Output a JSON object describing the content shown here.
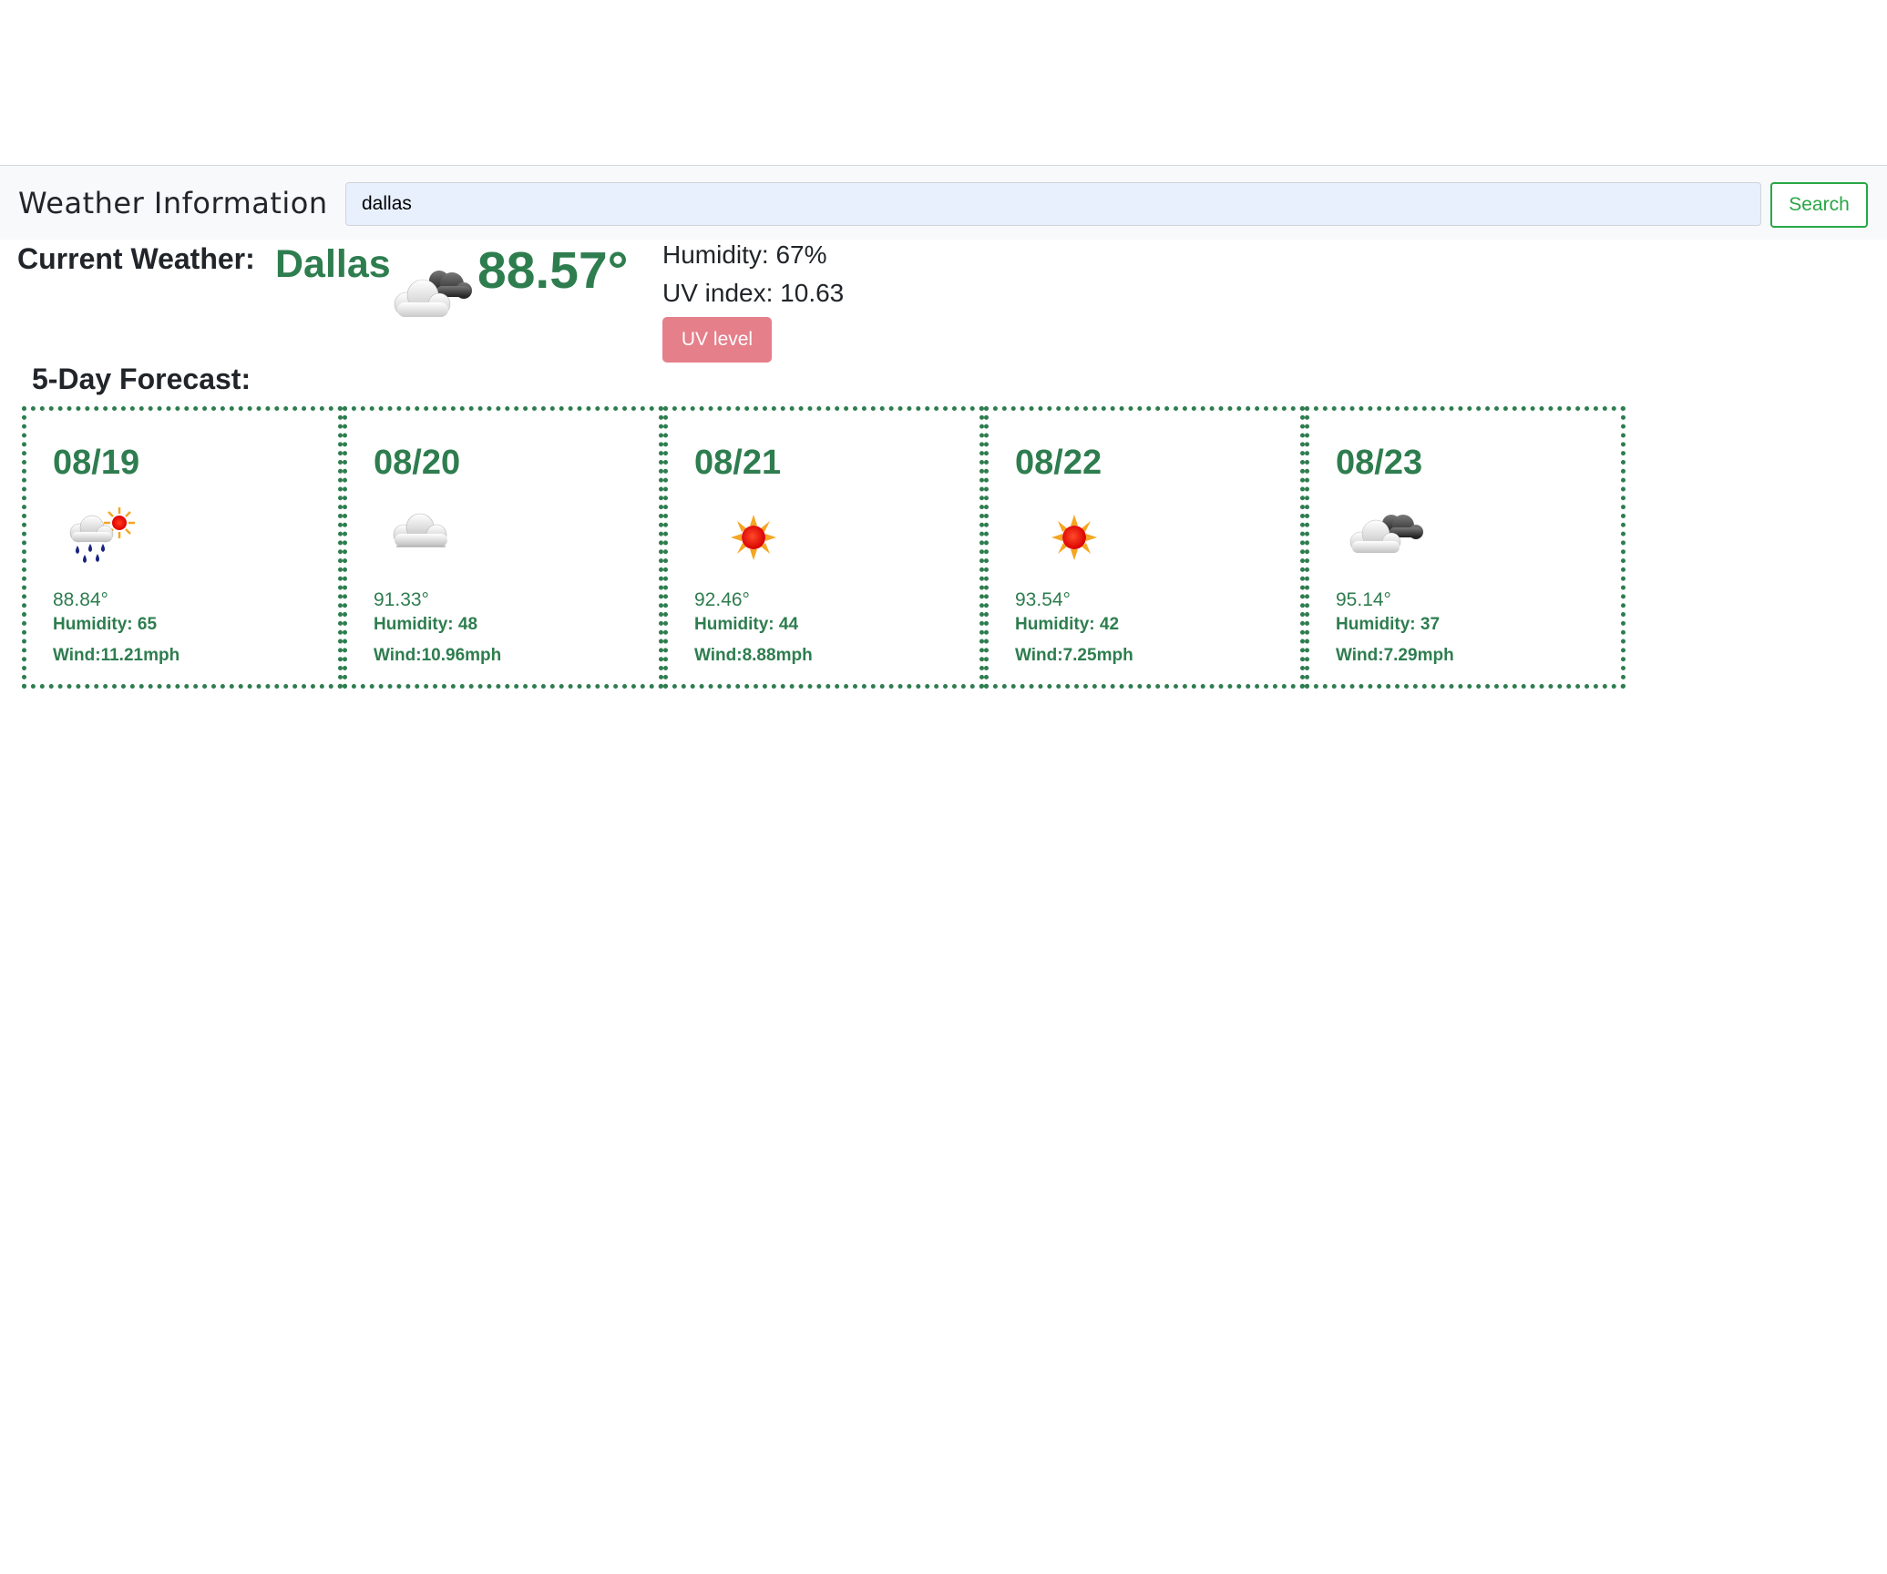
{
  "navbar": {
    "title": "Weather Information",
    "search_value": "dallas",
    "search_button": "Search"
  },
  "current": {
    "label": "Current Weather:",
    "city": "Dallas",
    "icon": "partly-cloudy-icon",
    "temp": "88.57°",
    "humidity": "Humidity: 67%",
    "uv_index": "UV index: 10.63",
    "uv_button": "UV level"
  },
  "forecast": {
    "label": "5-Day Forecast:",
    "days": [
      {
        "date": "08/19",
        "icon": "rain-sun-icon",
        "temp": "88.84°",
        "humidity": "Humidity: 65",
        "wind": "Wind:11.21mph"
      },
      {
        "date": "08/20",
        "icon": "cloud-icon",
        "temp": "91.33°",
        "humidity": "Humidity: 48",
        "wind": "Wind:10.96mph"
      },
      {
        "date": "08/21",
        "icon": "sun-icon",
        "temp": "92.46°",
        "humidity": "Humidity: 44",
        "wind": "Wind:8.88mph"
      },
      {
        "date": "08/22",
        "icon": "sun-icon",
        "temp": "93.54°",
        "humidity": "Humidity: 42",
        "wind": "Wind:7.25mph"
      },
      {
        "date": "08/23",
        "icon": "partly-cloudy-icon",
        "temp": "95.14°",
        "humidity": "Humidity: 37",
        "wind": "Wind:7.29mph"
      }
    ]
  },
  "colors": {
    "accent": "#2e7d4f",
    "search_button": "#28a745",
    "uv_button": "#e57f8a",
    "navbar_bg": "#f8f9fa",
    "input_bg": "#e8f0fe"
  }
}
